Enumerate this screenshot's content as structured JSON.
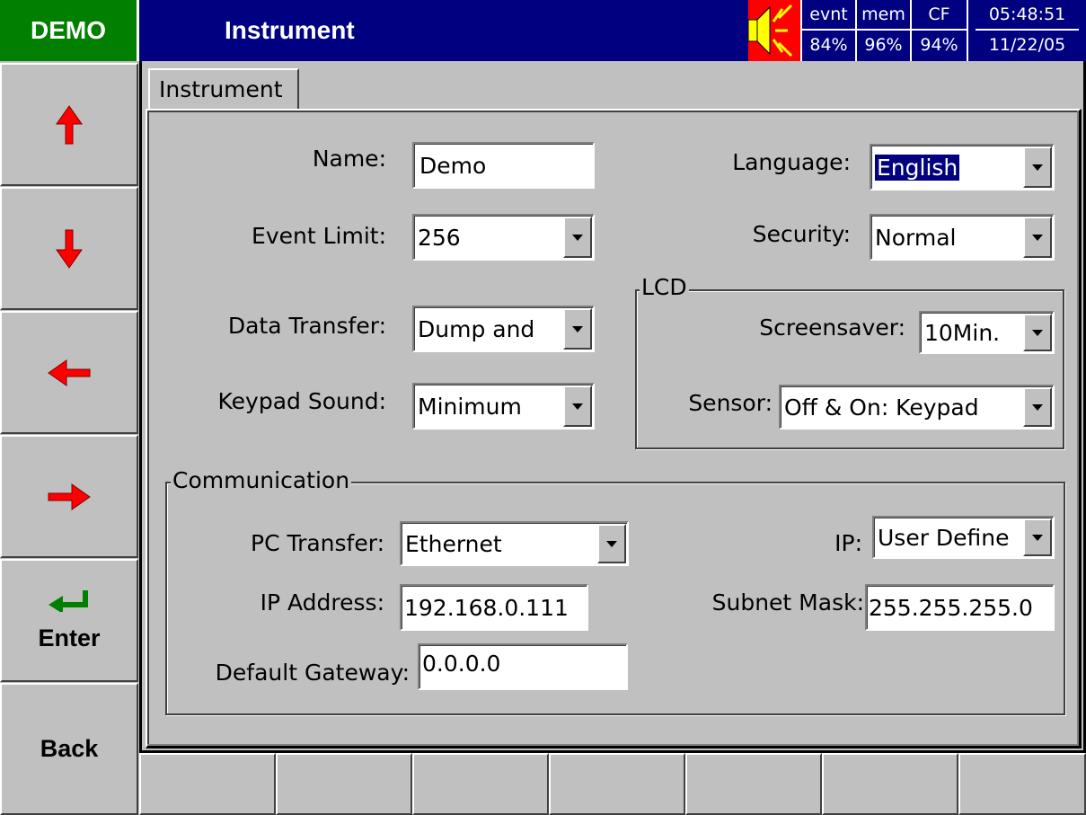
{
  "header": {
    "badge": "DEMO",
    "title": "Instrument",
    "status": [
      {
        "label": "evnt",
        "value": "84%"
      },
      {
        "label": "mem",
        "value": "96%"
      },
      {
        "label": "CF",
        "value": "94%"
      }
    ],
    "time": "05:48:51",
    "date": "11/22/05"
  },
  "sidebar": {
    "enter_label": "Enter",
    "back_label": "Back"
  },
  "tab": {
    "label": "Instrument"
  },
  "form": {
    "name": {
      "label": "Name:",
      "value": "Demo"
    },
    "event_limit": {
      "label": "Event Limit:",
      "value": "256"
    },
    "data_transfer": {
      "label": "Data Transfer:",
      "value": "Dump and"
    },
    "keypad_sound": {
      "label": "Keypad Sound:",
      "value": "Minimum"
    },
    "language": {
      "label": "Language:",
      "value": "English"
    },
    "security": {
      "label": "Security:",
      "value": "Normal"
    },
    "lcd": {
      "title": "LCD",
      "screensaver": {
        "label": "Screensaver:",
        "value": "10Min."
      },
      "sensor": {
        "label": "Sensor:",
        "value": "Off & On: Keypad"
      }
    },
    "communication": {
      "title": "Communication",
      "pc_transfer": {
        "label": "PC Transfer:",
        "value": "Ethernet"
      },
      "ip": {
        "label": "IP:",
        "value": "User Define"
      },
      "ip_address": {
        "label": "IP Address:",
        "value": "192.168.0.111"
      },
      "subnet_mask": {
        "label": "Subnet Mask:",
        "value": "255.255.255.0"
      },
      "default_gateway": {
        "label": "Default Gateway:",
        "value": "0.0.0.0"
      }
    }
  },
  "colors": {
    "badge_bg": "#007f00",
    "titlebar_bg": "#000080",
    "arrow": "#ff0000",
    "enter_arrow": "#008000",
    "face": "#c0c0c0"
  }
}
